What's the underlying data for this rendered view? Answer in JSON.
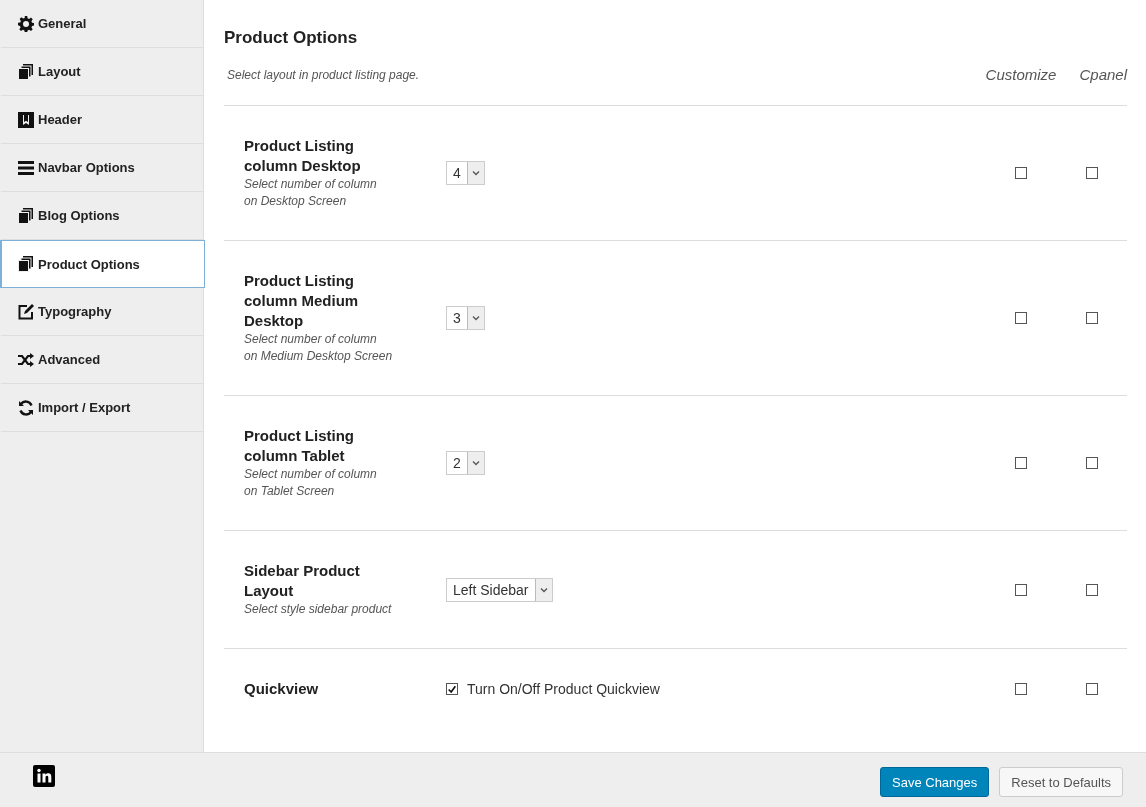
{
  "sidebar": {
    "items": [
      {
        "label": "General",
        "kind": "gear",
        "selected": false
      },
      {
        "label": "Layout",
        "kind": "copy",
        "selected": false
      },
      {
        "label": "Header",
        "kind": "header",
        "selected": false
      },
      {
        "label": "Navbar Options",
        "kind": "bars",
        "selected": false
      },
      {
        "label": "Blog Options",
        "kind": "copy",
        "selected": false
      },
      {
        "label": "Product Options",
        "kind": "copy",
        "selected": true
      },
      {
        "label": "Typography",
        "kind": "edit",
        "selected": false
      },
      {
        "label": "Advanced",
        "kind": "shuffle",
        "selected": false
      },
      {
        "label": "Import / Export",
        "kind": "refresh",
        "selected": false
      }
    ]
  },
  "section": {
    "title": "Product Options",
    "description": "Select layout in product listing page.",
    "columns": [
      "Customize",
      "Cpanel"
    ]
  },
  "options": [
    {
      "kind": "select",
      "title": "Product Listing column Desktop",
      "description": "Select number of column\non Desktop Screen",
      "value": "4",
      "customize": false,
      "cpanel": false
    },
    {
      "kind": "select",
      "title": "Product Listing column Medium Desktop",
      "description": "Select number of column\non Medium Desktop Screen",
      "value": "3",
      "customize": false,
      "cpanel": false
    },
    {
      "kind": "select",
      "title": "Product Listing column Tablet",
      "description": "Select number of column\non Tablet Screen",
      "value": "2",
      "customize": false,
      "cpanel": false
    },
    {
      "kind": "select",
      "title": "Sidebar Product Layout",
      "description": "Select style sidebar product",
      "value": "Left Sidebar",
      "customize": false,
      "cpanel": false
    },
    {
      "kind": "checkbox",
      "title": "Quickview",
      "label": "Turn On/Off Product Quickview",
      "checked": true,
      "customize": false,
      "cpanel": false
    }
  ],
  "footer": {
    "buttons": [
      {
        "label": "Save Changes",
        "kind": "primary"
      },
      {
        "label": "Reset to Defaults",
        "kind": "secondary"
      }
    ]
  }
}
